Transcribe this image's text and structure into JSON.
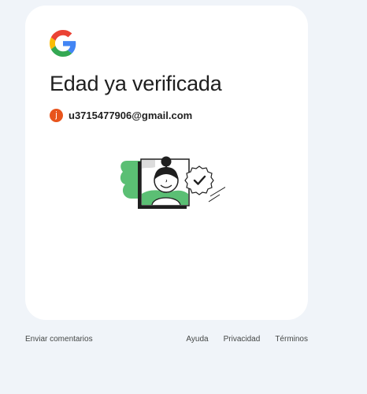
{
  "card": {
    "logo_icon": "google-g-icon",
    "title": "Edad ya verificada",
    "account": {
      "avatar_initial": "j",
      "avatar_color": "#e8541c",
      "email": "u3715477906@gmail.com"
    },
    "illustration_icon": "age-verified-illustration"
  },
  "footer": {
    "feedback_label": "Enviar comentarios",
    "links": [
      "Ayuda",
      "Privacidad",
      "Términos"
    ]
  },
  "colors": {
    "background": "#f0f4f9",
    "card": "#ffffff",
    "illustration_green": "#5bbf74",
    "text": "#1f1f1f",
    "footer_text": "#444746"
  }
}
